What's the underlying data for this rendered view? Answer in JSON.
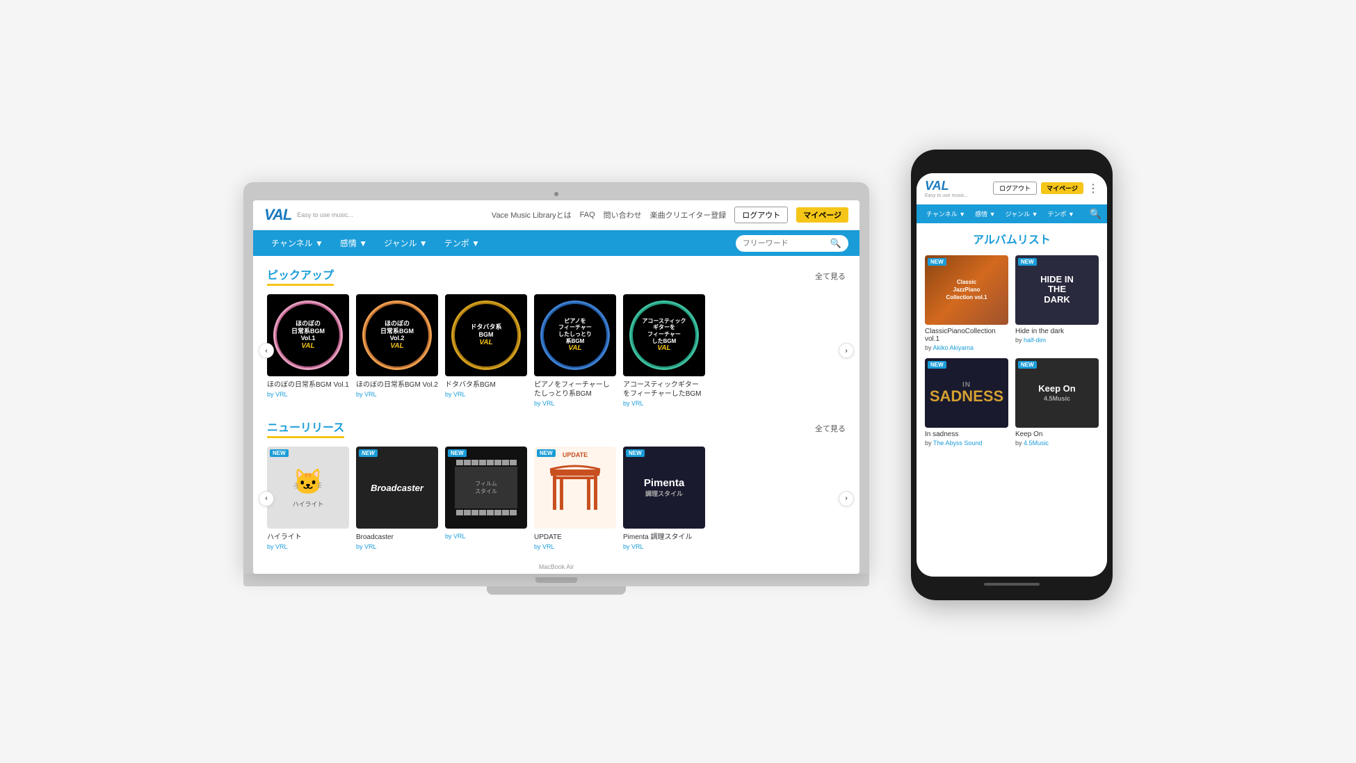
{
  "laptop": {
    "model": "MacBook Air",
    "header": {
      "logo": "VAL",
      "tagline": "Easy to use music...",
      "nav_links": [
        "Vace Music Libraryとは",
        "FAQ",
        "問い合わせ",
        "楽曲クリエイター登録"
      ],
      "btn_logout": "ログアウト",
      "btn_mypage": "マイページ"
    },
    "navbar": {
      "items": [
        "チャンネル ▼",
        "感情 ▼",
        "ジャンル ▼",
        "テンポ ▼"
      ],
      "search_placeholder": "フリーワード"
    },
    "pickup": {
      "section_title": "ピックアップ",
      "see_all": "全て見る",
      "albums": [
        {
          "title": "ほのぼの日常系BGM Vol.1",
          "by": "by VRL",
          "style": "pink"
        },
        {
          "title": "ほのぼの日常系BGM Vol.2",
          "by": "by VRL",
          "style": "orange"
        },
        {
          "title": "ドタバタ系BGM",
          "by": "by VRL",
          "style": "gold"
        },
        {
          "title": "ピアノをフィーチャーしたしっとり系BGM",
          "by": "by VRL",
          "style": "blue"
        },
        {
          "title": "アコースティックギターをフィーチャーしたBGM",
          "by": "by VRL",
          "style": "teal"
        }
      ]
    },
    "new_releases": {
      "section_title": "ニューリリース",
      "see_all": "全て見る",
      "albums": [
        {
          "title": "ハイライト",
          "by": "by VRL",
          "style": "cat",
          "new": true
        },
        {
          "title": "Broadcaster",
          "by": "by VRL",
          "style": "broadcaster",
          "new": true
        },
        {
          "title": "",
          "by": "by VRL",
          "style": "film",
          "new": true
        },
        {
          "title": "UPDATE",
          "by": "by VRL",
          "style": "torii",
          "new": true
        },
        {
          "title": "Pimenta 調理スタイル",
          "by": "by VRL",
          "style": "pimenta",
          "new": true
        }
      ]
    }
  },
  "phone": {
    "header": {
      "logo": "VAL",
      "tagline": "Easy to use music...",
      "btn_logout": "ログアウト",
      "btn_mypage": "マイページ"
    },
    "navbar": {
      "items": [
        "チャンネル ▼",
        "感情 ▼",
        "ジャンル ▼",
        "テンポ ▼"
      ]
    },
    "album_list": {
      "section_title": "アルバムリスト",
      "albums": [
        {
          "title": "ClassicPianoCollection vol.1",
          "by": "Akiko Akiyama",
          "style": "classic-piano",
          "new": true
        },
        {
          "title": "Hide in the dark",
          "by": "half-dim",
          "style": "hide-dark",
          "new": true
        },
        {
          "title": "In sadness",
          "by": "The Abyss Sound",
          "style": "in-sadness",
          "new": true
        },
        {
          "title": "Keep On",
          "by": "4.5Music",
          "style": "keep-on",
          "new": true
        }
      ]
    }
  }
}
